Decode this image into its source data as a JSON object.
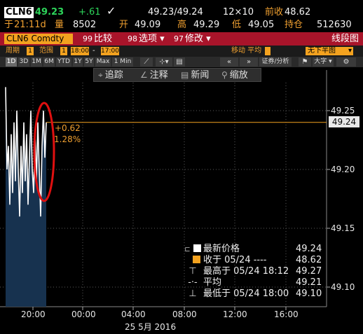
{
  "quote": {
    "ticker": "CLN6",
    "last": "49.23",
    "change": "+.61",
    "bid_ask": "49.23/49.24",
    "size": "12×10",
    "prev_close_label": "前收",
    "prev_close": "48.62",
    "time_label": "于",
    "time": "21:11d",
    "volume_label": "量",
    "volume": "8502",
    "open_label": "开",
    "open": "49.09",
    "high_label": "高",
    "high": "49.29",
    "low_label": "低",
    "low": "49.05",
    "oi_label": "持仓",
    "oi": "512630"
  },
  "secbar": {
    "security": "CLN6 Comdty",
    "compare_num": "99",
    "compare": "比较",
    "options_num": "98",
    "options": "选项",
    "edit_num": "97",
    "edit": "修改",
    "chart_type": "线段图"
  },
  "rangebar": {
    "period_label": "周期",
    "period_val": "1",
    "range_label": "范围",
    "range_val": "1",
    "start_time": "18:00",
    "end_time": "17:00",
    "move_avg": "移动 平均",
    "sub_chart": "无下半图"
  },
  "tfbar": {
    "frames": [
      "1D",
      "3D",
      "1M",
      "6M",
      "YTD",
      "1Y",
      "5Y",
      "Max"
    ],
    "interval": "1 Min",
    "security_analysis": "证券/分析",
    "bigger": "大字"
  },
  "annot": {
    "track": "追踪",
    "note": "注释",
    "news": "新闻",
    "zoom": "缩放"
  },
  "chart_data": {
    "type": "line",
    "y_ticks": [
      "49.25",
      "49.20",
      "49.15",
      "49.10"
    ],
    "x_ticks": [
      "20:00",
      "00:00",
      "04:00",
      "08:00",
      "12:00",
      "16:00"
    ],
    "date_label": "25 5月 2016",
    "current_price": "49.24",
    "change_annotation": "+0.62",
    "change_pct": "1.28%",
    "ylim": [
      49.08,
      49.27
    ],
    "series": [
      {
        "name": "最新价格",
        "values": [
          49.27,
          49.2,
          49.22,
          49.17,
          49.23,
          49.18,
          49.24,
          49.19,
          49.25,
          49.2,
          49.16,
          49.22,
          49.18,
          49.24,
          49.19,
          49.23,
          49.17,
          49.21,
          49.25,
          49.2,
          49.18,
          49.23,
          49.19,
          49.24,
          49.2,
          49.16,
          49.22,
          49.25,
          49.21,
          49.24
        ]
      }
    ]
  },
  "legend": {
    "last_price": {
      "label": "最新价格",
      "value": "49.24",
      "color": "#ffffff"
    },
    "close": {
      "label": "收于 05/24 ----",
      "value": "48.62",
      "color": "#f3a21f"
    },
    "high": {
      "label": "最高于 05/24 18:12",
      "value": "49.27"
    },
    "avg": {
      "label": "平均",
      "value": "49.21"
    },
    "low": {
      "label": "最低于 05/24 18:00",
      "value": "49.10"
    }
  }
}
